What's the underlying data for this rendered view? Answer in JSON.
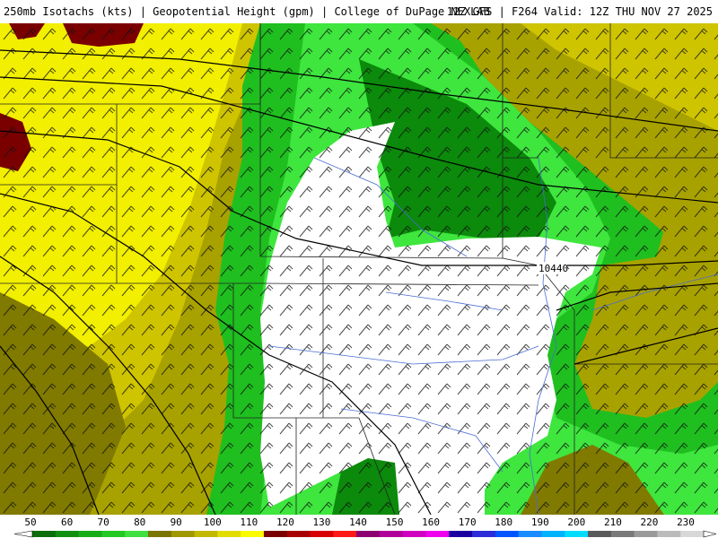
{
  "header": {
    "left_text": "250mb Isotachs (kts) | Geopotential Height (gpm) | College of DuPage NEXLAB",
    "right_text": "12Z GFS | F264 Valid: 12Z THU NOV 27 2025"
  },
  "map": {
    "contour_label": "10440",
    "colors": {
      "calm": "#ffffff",
      "green_dark": "#0b8a0b",
      "green_mid": "#1fbf1f",
      "green_bright": "#3ee63e",
      "olive_dark": "#807a00",
      "olive": "#a8a200",
      "olive_light": "#cfc400",
      "yellow": "#f2ef00",
      "maroon": "#7a0000"
    }
  },
  "legend": {
    "labels": [
      "50",
      "60",
      "70",
      "80",
      "90",
      "100",
      "110",
      "120",
      "130",
      "140",
      "150",
      "160",
      "170",
      "180",
      "190",
      "200",
      "210",
      "220",
      "230"
    ],
    "colors": [
      "#0b6e0b",
      "#118f11",
      "#17ad17",
      "#22c922",
      "#3fe03f",
      "#7a7400",
      "#a09800",
      "#c2b900",
      "#e3dc00",
      "#fbfb00",
      "#7a0000",
      "#a80000",
      "#d80000",
      "#ff1a1a",
      "#8c0070",
      "#b0009a",
      "#d000c0",
      "#ee00ee",
      "#1a00a0",
      "#2c2cd8",
      "#0055ff",
      "#1a8cff",
      "#00b3ff",
      "#00dcff",
      "#5a5a5a",
      "#7a7a7a",
      "#9a9a9a",
      "#bbbbbb",
      "#d8d8d8"
    ]
  }
}
